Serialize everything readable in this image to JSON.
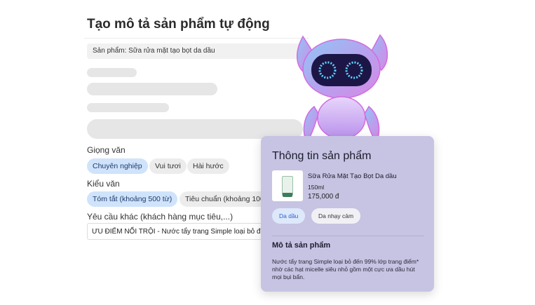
{
  "page": {
    "title": "Tạo mô tả sản phẩm tự động",
    "product_field_value": "Sản phẩm: Sữa rửa mặt tạo bọt da dầu"
  },
  "voice": {
    "label": "Giọng văn",
    "options": [
      "Chuyên nghiệp",
      "Vui tươi",
      "Hài hước"
    ],
    "selected": "Chuyên nghiệp"
  },
  "style": {
    "label": "Kiểu văn",
    "options": [
      "Tóm tắt (khoảng 500 từ)",
      "Tiêu chuẩn (khoảng 100"
    ],
    "selected": "Tóm tắt (khoảng 500 từ)"
  },
  "requirements": {
    "label": "Yêu cầu khác (khách hàng mục tiêu,...)",
    "value": "ƯU ĐIỂM NỔI TRỘI - Nước tẩy trang Simple loại bỏ đ"
  },
  "product_card": {
    "title": "Thông tin sản phẩm",
    "name": "Sữa Rửa Mặt Tạo Bọt Da dầu",
    "volume": "150ml",
    "price": "175,000 đ",
    "tags": [
      "Da dầu",
      "Da nhạy cảm"
    ],
    "description_heading": "Mô tả sản phẩm",
    "description": "Nước tẩy trang Simple loại bỏ đến 99% lớp trang điểm* nhờ các hạt micelle siêu nhỏ gồm một cực ưa dầu hút mọi bụi bẩn."
  },
  "colors": {
    "chip_active": "#cfe3fb",
    "card_bg": "#c6c4e2",
    "tag_active_text": "#2a63c9"
  }
}
